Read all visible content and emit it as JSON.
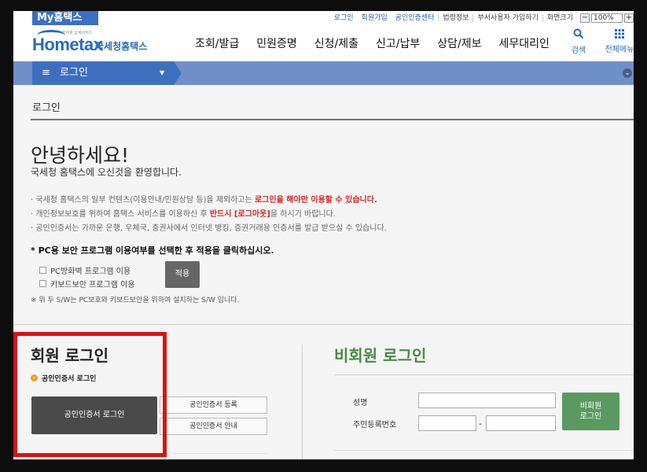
{
  "topbar": {
    "my_hometax": "My홈택스",
    "links": [
      "로그인",
      "회원가입",
      "공인인증센터",
      "법령정보",
      "부서사용자 가입하기",
      "화면크기"
    ],
    "zoom_minus": "−",
    "zoom_value": "100%",
    "zoom_plus": "+"
  },
  "header": {
    "logo_tiny": "전자로 납세서비스",
    "logo_main": "Hometax",
    "logo_sub": "국세청홈택스",
    "nav": [
      "조회/발급",
      "민원증명",
      "신청/제출",
      "신고/납부",
      "상담/제보",
      "세무대리인"
    ],
    "search_label": "검색",
    "allmenu_label": "전체메뉴"
  },
  "breadcrumb": {
    "menu_glyph": "≡",
    "label": "로그인"
  },
  "page_title": "로그인",
  "hello": "안녕하세요!",
  "welcome": "국세청 홈택스에 오신것을 환영합니다.",
  "notes": [
    {
      "pre": "· 국세청 홈택스의 일부 컨텐츠(이용안내/민원상담 등)을 제외하고는 ",
      "red": "로그인을 해야만 이용할 수 있습니다.",
      "post": ""
    },
    {
      "pre": "· 개인정보보호를 위하여 홈택스 서비스를 이용하신 후 ",
      "red": "반드시 [로그아웃]",
      "post": "을 하시기 바랍니다."
    },
    {
      "pre": "· 공인인증서는 가까운 은행, 우체국, 증권사에서 인터넷 뱅킹, 증권거래용 인증서를 발급 받으실 수 있습니다.",
      "red": "",
      "post": ""
    }
  ],
  "security": {
    "title": "* PC용 보안 프로그램 이용여부를 선택한 후 적용을 클릭하십시오.",
    "firewall": "PC방화벽 프로그램 이용",
    "keyboard": "키보드보안 프로그램 이용",
    "apply": "적용",
    "note": "※ 위 두 S/W는 PC보호와 키보드보안을 위하여 설치하는 S/W 입니다."
  },
  "member": {
    "title": "회원 로그인",
    "cert_sub": "공인인증서 로그인",
    "cert_login_btn": "공인인증서 로그인",
    "cert_register_btn": "공인인증서 등록",
    "cert_guide_btn": "공인인증서 안내"
  },
  "nonmember": {
    "title": "비회원 로그인",
    "name_label": "성명",
    "rrn_label": "주민등록번호",
    "dash": "-",
    "login_btn_line1": "비회원",
    "login_btn_line2": "로그인"
  },
  "colors": {
    "brand_blue": "#3d6fbf",
    "nonmember_green": "#5a9a60",
    "highlight_red": "#e01010",
    "notice_red": "#dd2222"
  }
}
